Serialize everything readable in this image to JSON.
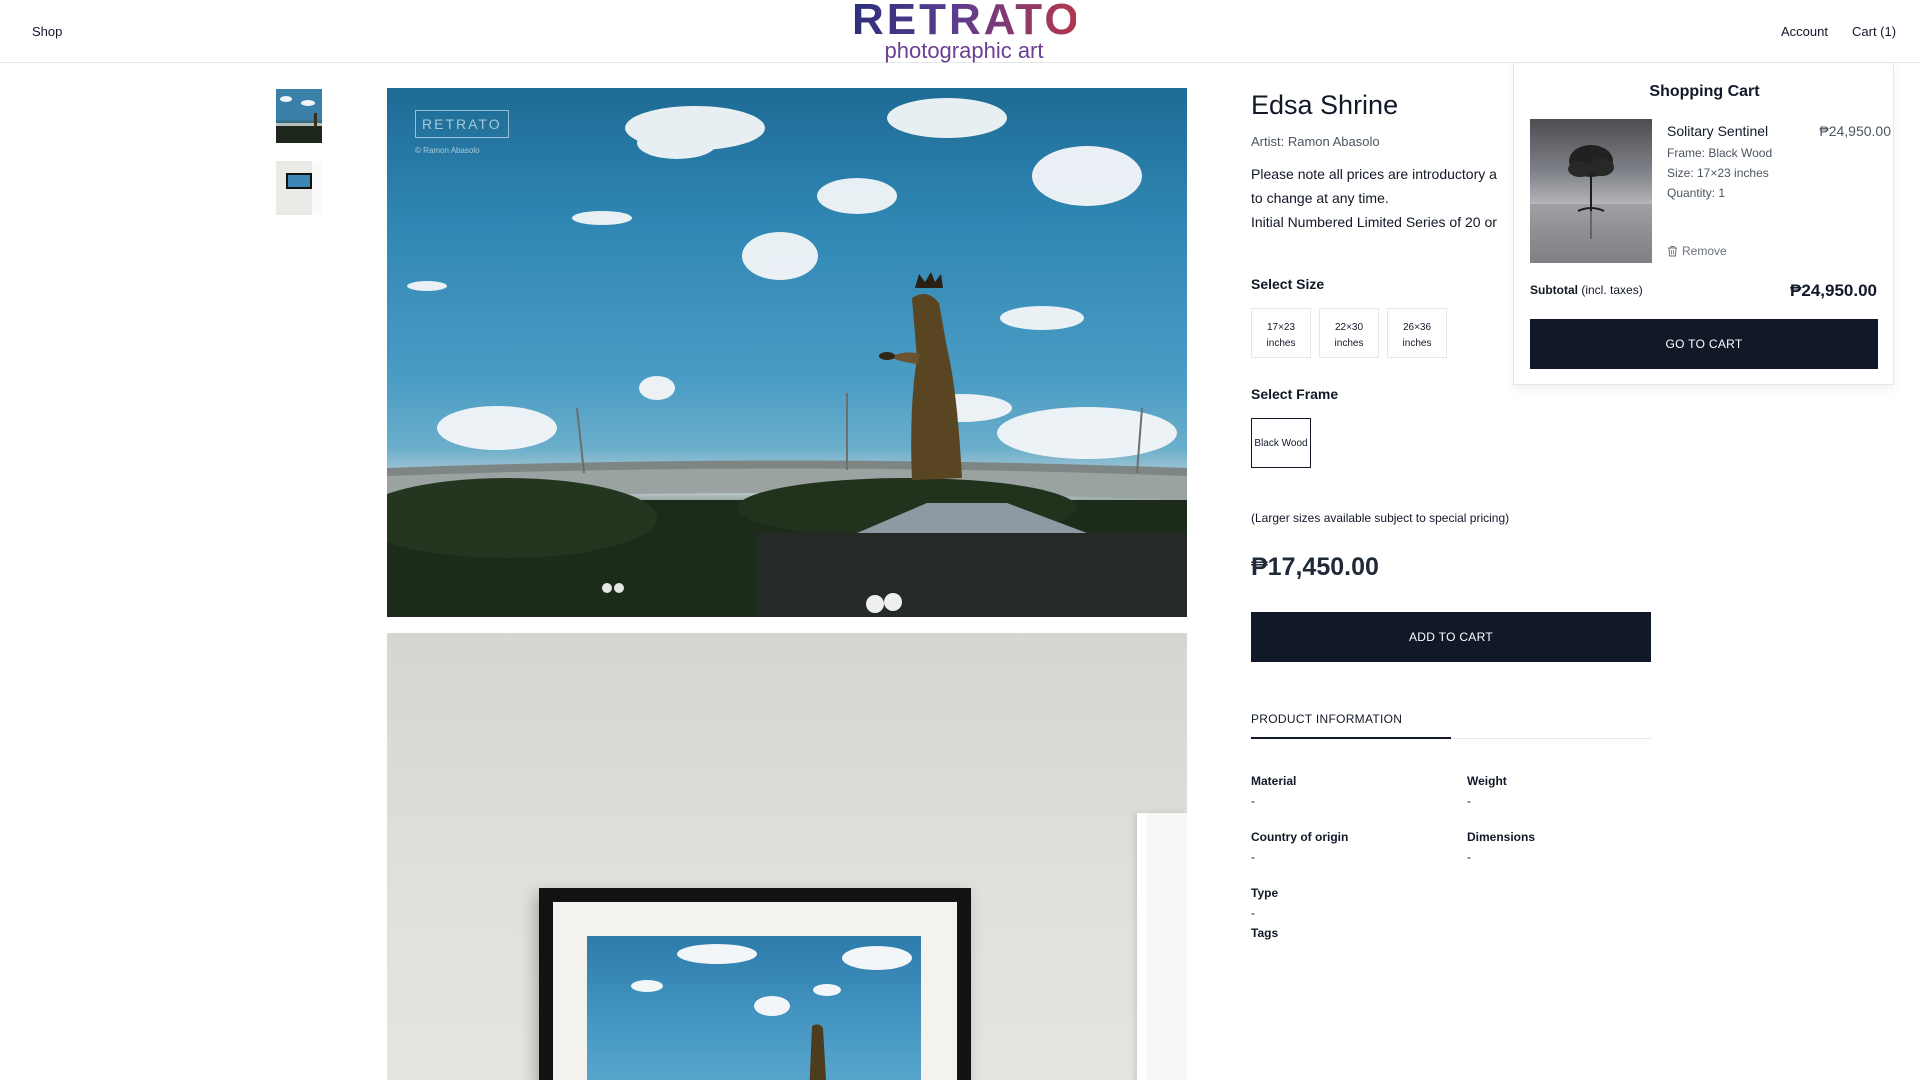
{
  "header": {
    "shop_label": "Shop",
    "logo_word": "RETRATO",
    "logo_sub": "photographic art",
    "account_label": "Account",
    "cart_label": "Cart (1)"
  },
  "gallery": {
    "watermark_title": "RETRATO",
    "watermark_credit": "© Ramon Abasolo"
  },
  "product": {
    "title": "Edsa Shrine",
    "artist": "Artist: Ramon Abasolo",
    "note_line1": "Please note all prices are introductory a",
    "note_line2": "to change at any time.",
    "note_line3": "Initial Numbered Limited Series of 20 or",
    "select_size_label": "Select Size",
    "sizes": [
      {
        "line1": "17×23",
        "line2": "inches"
      },
      {
        "line1": "22×30",
        "line2": "inches"
      },
      {
        "line1": "26×36",
        "line2": "inches"
      }
    ],
    "select_frame_label": "Select Frame",
    "frame_option": "Black Wood",
    "larger_note": "(Larger sizes available subject to special pricing)",
    "price": "₱17,450.00",
    "add_to_cart": "ADD TO CART",
    "info_tab": "PRODUCT INFORMATION",
    "attributes": {
      "material_label": "Material",
      "material_value": "-",
      "weight_label": "Weight",
      "weight_value": "-",
      "origin_label": "Country of origin",
      "origin_value": "-",
      "dimensions_label": "Dimensions",
      "dimensions_value": "-",
      "type_label": "Type",
      "type_value": "-",
      "tags_label": "Tags"
    }
  },
  "cart_drawer": {
    "title": "Shopping Cart",
    "item_name": "Solitary Sentinel",
    "item_price": "₱24,950.00",
    "item_frame": "Frame: Black Wood",
    "item_size": "Size: 17×23 inches",
    "item_quantity": "Quantity: 1",
    "remove_label": "Remove",
    "subtotal_label": "Subtotal",
    "subtotal_note": "(incl. taxes)",
    "subtotal_value": "₱24,950.00",
    "goto_cart": "GO TO CART"
  },
  "colors": {
    "primary_button": "#111827",
    "logo_gradient_start": "#2d2f7a",
    "logo_gradient_end": "#b2364f"
  }
}
